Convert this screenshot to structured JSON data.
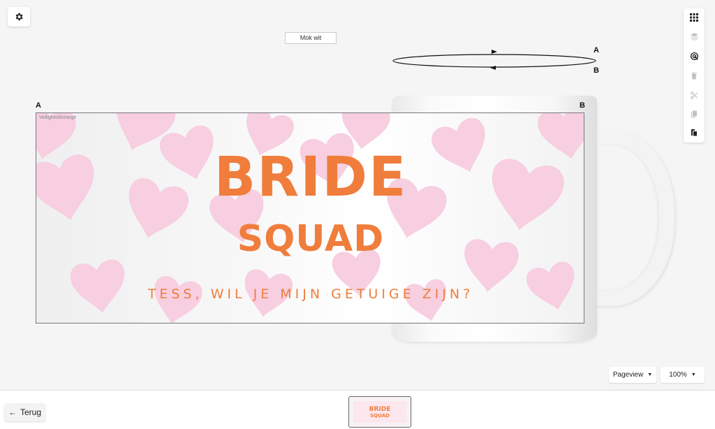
{
  "header": {
    "settings_icon": "gear-icon"
  },
  "product_label": "Mok wit",
  "rotation_guide": {
    "top_label": "A",
    "bottom_label": "B"
  },
  "print_area": {
    "corner_left": "A",
    "corner_right": "B",
    "safety_margin_label": "Veiligheidsmarge",
    "lines": [
      "BRIDE",
      "SQUAD",
      "TESS, WIL JE MIJN GETUIGE ZIJN?"
    ],
    "text_color": "#f07d3c",
    "heart_color": "#f7cfe0"
  },
  "toolbar": [
    {
      "icon": "grid-icon",
      "enabled": true
    },
    {
      "icon": "layers-icon",
      "enabled": false
    },
    {
      "icon": "target-icon",
      "enabled": true
    },
    {
      "icon": "trash-icon",
      "enabled": false
    },
    {
      "icon": "scissors-icon",
      "enabled": false
    },
    {
      "icon": "copy-icon",
      "enabled": false
    },
    {
      "icon": "paste-icon",
      "enabled": true
    }
  ],
  "view_select": {
    "value": "Pageview"
  },
  "zoom_select": {
    "value": "100%"
  },
  "footer": {
    "back_label": "Terug",
    "thumbnail": {
      "line1": "BRIDE",
      "line2": "SQUAD"
    }
  }
}
